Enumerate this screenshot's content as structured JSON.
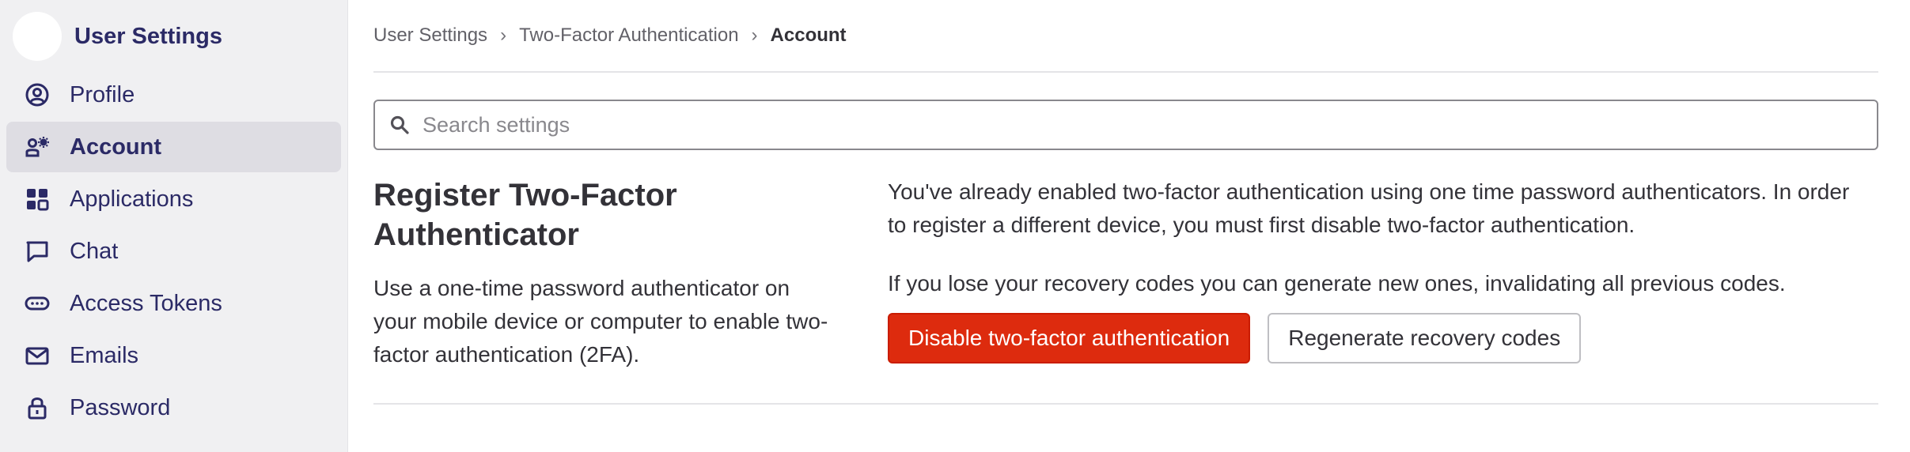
{
  "sidebar": {
    "title": "User Settings",
    "items": [
      {
        "label": "Profile",
        "icon": "profile-icon",
        "active": false
      },
      {
        "label": "Account",
        "icon": "account-icon",
        "active": true
      },
      {
        "label": "Applications",
        "icon": "applications-icon",
        "active": false
      },
      {
        "label": "Chat",
        "icon": "chat-icon",
        "active": false
      },
      {
        "label": "Access Tokens",
        "icon": "token-icon",
        "active": false
      },
      {
        "label": "Emails",
        "icon": "mail-icon",
        "active": false
      },
      {
        "label": "Password",
        "icon": "lock-icon",
        "active": false
      }
    ]
  },
  "breadcrumb": {
    "items": [
      "User Settings",
      "Two-Factor Authentication"
    ],
    "current": "Account",
    "separator": "›"
  },
  "search": {
    "placeholder": "Search settings",
    "value": ""
  },
  "section": {
    "title": "Register Two-Factor Authenticator",
    "description": "Use a one-time password authenticator on your mobile device or computer to enable two-factor authentication (2FA).",
    "paragraph1": "You've already enabled two-factor authentication using one time password authenticators. In order to register a different device, you must first disable two-factor authentication.",
    "paragraph2": "If you lose your recovery codes you can generate new ones, invalidating all previous codes.",
    "disable_button": "Disable two-factor authentication",
    "regenerate_button": "Regenerate recovery codes"
  },
  "colors": {
    "sidebar_bg": "#f0f0f2",
    "sidebar_text": "#2b2a66",
    "active_bg": "#dedde3",
    "danger": "#dd2b0e"
  }
}
